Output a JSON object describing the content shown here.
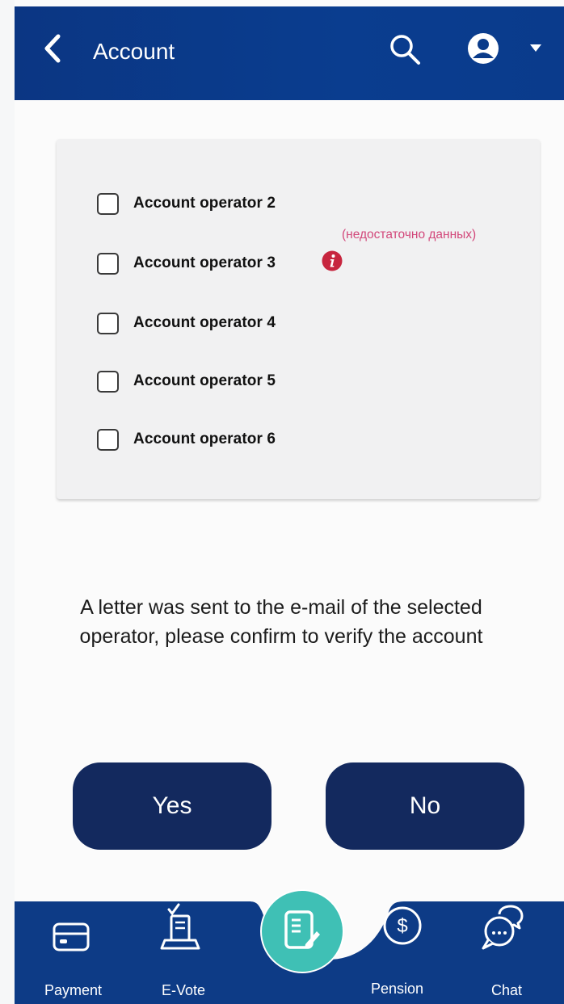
{
  "header": {
    "title": "Account"
  },
  "operators": [
    {
      "label": "Account operator 2",
      "checked": false
    },
    {
      "label": "Account operator 3",
      "checked": false,
      "note": "(недостаточно данных)"
    },
    {
      "label": "Account operator 4",
      "checked": false
    },
    {
      "label": "Account operator 5",
      "checked": false
    },
    {
      "label": "Account operator 6",
      "checked": false
    }
  ],
  "message": "A letter was sent to the e-mail of the selected operator, please confirm to verify the account",
  "actions": {
    "yes": "Yes",
    "no": "No"
  },
  "nav": {
    "payment": "Payment",
    "evote": "E-Vote",
    "pension": "Pension",
    "chat": "Chat"
  },
  "icons": {
    "back": "chevron-left-icon",
    "search": "search-icon",
    "profile": "user-icon",
    "dropdown": "caret-down-icon",
    "info": "info-icon",
    "payment": "credit-card-icon",
    "evote": "ballot-icon",
    "center": "document-edit-icon",
    "pension": "dollar-circle-icon",
    "chat": "chat-bubbles-icon"
  },
  "colors": {
    "header": "#0a3b8a",
    "button": "#13295e",
    "nav": "#0d3b86",
    "fab": "#3fc0b5",
    "warning": "#d2477a"
  }
}
